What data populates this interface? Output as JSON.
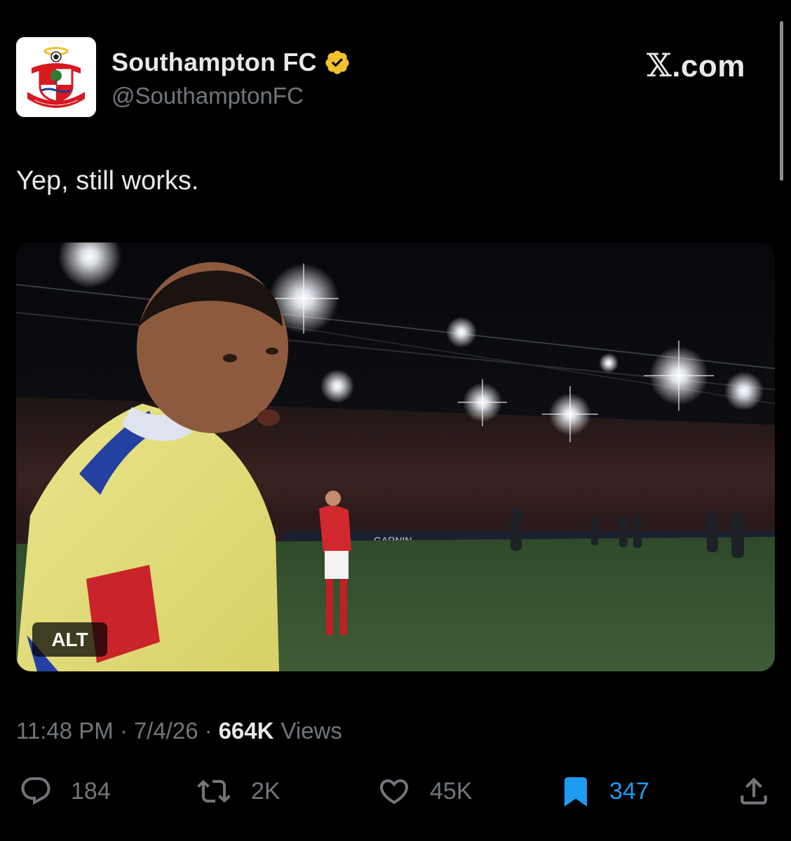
{
  "account": {
    "display_name": "Southampton FC",
    "handle": "@SouthamptonFC",
    "verified": true,
    "verified_color": "#f2c12e",
    "logo_text": "SOUTHAMPTON F.C.",
    "logo_colors": {
      "red": "#d71920",
      "yellow": "#f2c12e",
      "blue": "#1a3d8f"
    }
  },
  "brand": {
    "mark": "𝕏",
    "suffix": ".com"
  },
  "tweet": {
    "text": "Yep, still works.",
    "media": {
      "alt_label": "ALT",
      "ad_board_text": "GARNIN"
    }
  },
  "meta": {
    "time": "11:48 PM",
    "separator": "·",
    "date": "7/4/26",
    "views_count": "664K",
    "views_label": "Views"
  },
  "actions": {
    "replies": {
      "icon": "reply-icon",
      "count": "184"
    },
    "reposts": {
      "icon": "repost-icon",
      "count": "2K"
    },
    "likes": {
      "icon": "like-icon",
      "count": "45K"
    },
    "bookmarks": {
      "icon": "bookmark-icon",
      "count": "347",
      "active": true,
      "color": "#1d9bf0"
    },
    "share": {
      "icon": "share-icon"
    }
  },
  "colors": {
    "background": "#000000",
    "primary_text": "#e7e9ea",
    "secondary_text": "#71767b",
    "accent": "#1d9bf0"
  }
}
